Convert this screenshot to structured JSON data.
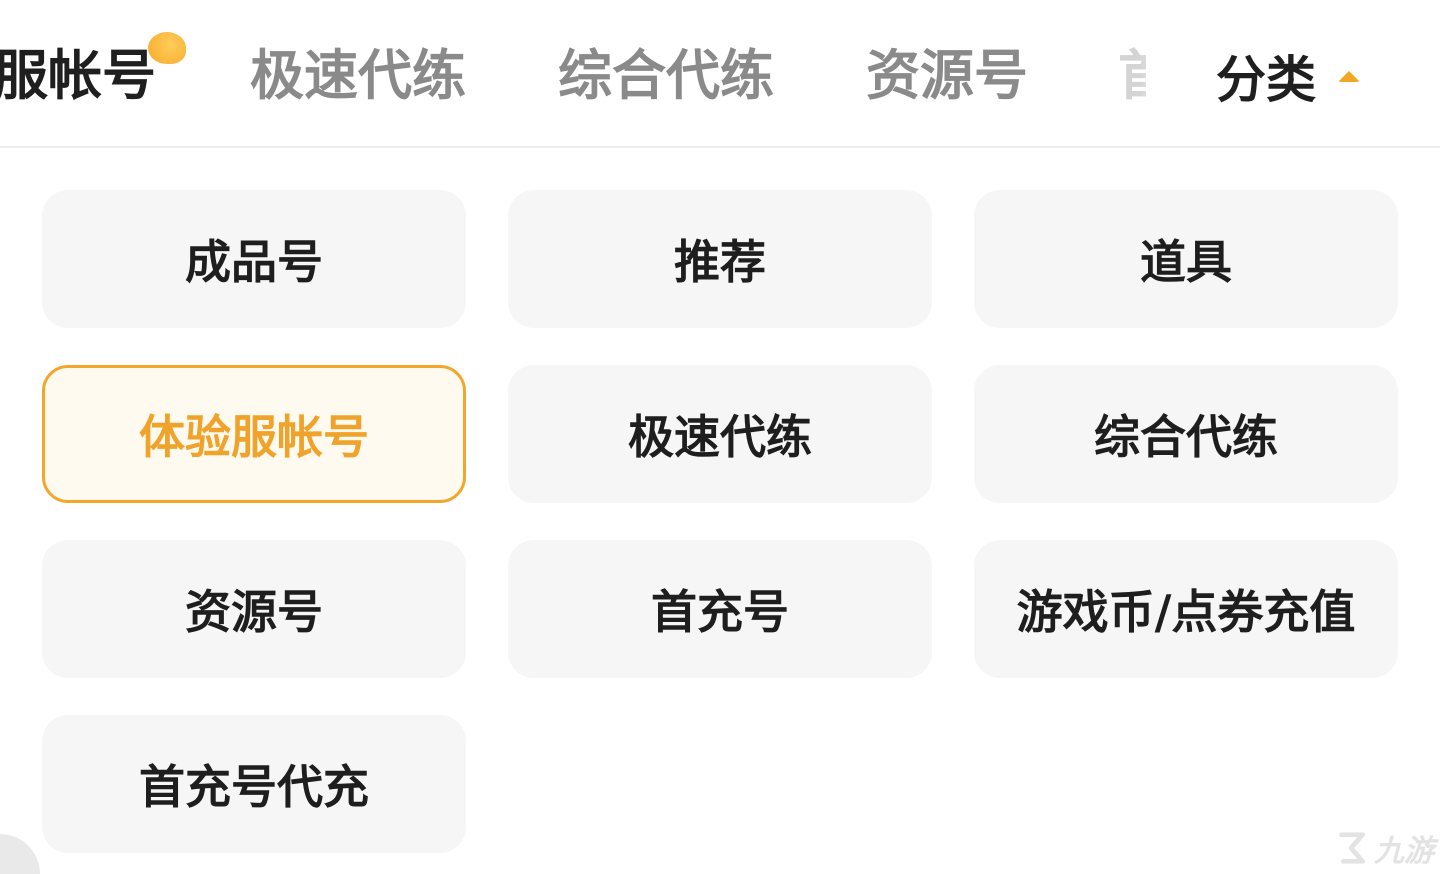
{
  "tabs": {
    "active": "服帐号",
    "items": [
      "极速代练",
      "综合代练",
      "资源号"
    ],
    "partial": "首"
  },
  "category": {
    "label": "分类"
  },
  "options": [
    "成品号",
    "推荐",
    "道具",
    "体验服帐号",
    "极速代练",
    "综合代练",
    "资源号",
    "首充号",
    "游戏币/点券充值",
    "首充号代充"
  ],
  "selected_option": "体验服帐号",
  "colors": {
    "accent": "#f2a62a",
    "chip_bg": "#f6f6f6",
    "text": "#1e1e1e"
  },
  "watermark": {
    "text": "九游",
    "icon": "jiuyou-logo-icon"
  }
}
